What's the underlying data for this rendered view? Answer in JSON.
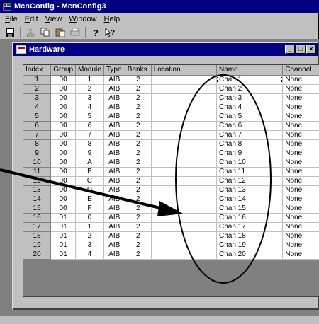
{
  "app": {
    "title": "McnConfig - McnConfig3"
  },
  "menu": [
    {
      "label": "File"
    },
    {
      "label": "Edit"
    },
    {
      "label": "View"
    },
    {
      "label": "Window"
    },
    {
      "label": "Help"
    }
  ],
  "toolbar": {
    "buttons": [
      "save-icon",
      "cut-icon",
      "copy-icon",
      "paste-icon",
      "print-icon",
      "help-icon",
      "context-help-icon"
    ]
  },
  "child_window": {
    "title": "Hardware",
    "buttons": {
      "minimize": "_",
      "maximize": "□",
      "close": "×"
    }
  },
  "table": {
    "columns": [
      "Index",
      "Group",
      "Module",
      "Type",
      "Banks",
      "Location",
      "Name",
      "Channel"
    ],
    "rows": [
      [
        "1",
        "00",
        "1",
        "AIB",
        "2",
        "",
        "Chan 1",
        "None"
      ],
      [
        "2",
        "00",
        "2",
        "AIB",
        "2",
        "",
        "Chan 2",
        "None"
      ],
      [
        "3",
        "00",
        "3",
        "AIB",
        "2",
        "",
        "Chan 3",
        "None"
      ],
      [
        "4",
        "00",
        "4",
        "AIB",
        "2",
        "",
        "Chan 4",
        "None"
      ],
      [
        "5",
        "00",
        "5",
        "AIB",
        "2",
        "",
        "Chan 5",
        "None"
      ],
      [
        "6",
        "00",
        "6",
        "AIB",
        "2",
        "",
        "Chan 6",
        "None"
      ],
      [
        "7",
        "00",
        "7",
        "AIB",
        "2",
        "",
        "Chan 7",
        "None"
      ],
      [
        "8",
        "00",
        "8",
        "AIB",
        "2",
        "",
        "Chan 8",
        "None"
      ],
      [
        "9",
        "00",
        "9",
        "AIB",
        "2",
        "",
        "Chan 9",
        "None"
      ],
      [
        "10",
        "00",
        "A",
        "AIB",
        "2",
        "",
        "Chan 10",
        "None"
      ],
      [
        "11",
        "00",
        "B",
        "AIB",
        "2",
        "",
        "Chan 11",
        "None"
      ],
      [
        "12",
        "00",
        "C",
        "AIB",
        "2",
        "",
        "Chan 12",
        "None"
      ],
      [
        "13",
        "00",
        "D",
        "AIB",
        "2",
        "",
        "Chan 13",
        "None"
      ],
      [
        "14",
        "00",
        "E",
        "AIB",
        "2",
        "",
        "Chan 14",
        "None"
      ],
      [
        "15",
        "00",
        "F",
        "AIB",
        "2",
        "",
        "Chan 15",
        "None"
      ],
      [
        "16",
        "01",
        "0",
        "AIB",
        "2",
        "",
        "Chan 16",
        "None"
      ],
      [
        "17",
        "01",
        "1",
        "AIB",
        "2",
        "",
        "Chan 17",
        "None"
      ],
      [
        "18",
        "01",
        "2",
        "AIB",
        "2",
        "",
        "Chan 18",
        "None"
      ],
      [
        "19",
        "01",
        "3",
        "AIB",
        "2",
        "",
        "Chan 19",
        "None"
      ],
      [
        "20",
        "01",
        "4",
        "AIB",
        "2",
        "",
        "Chan 20",
        "None"
      ]
    ]
  },
  "colors": {
    "title_bar": "#000080",
    "window_face": "#c0c0c0",
    "mdi_background": "#808080"
  }
}
